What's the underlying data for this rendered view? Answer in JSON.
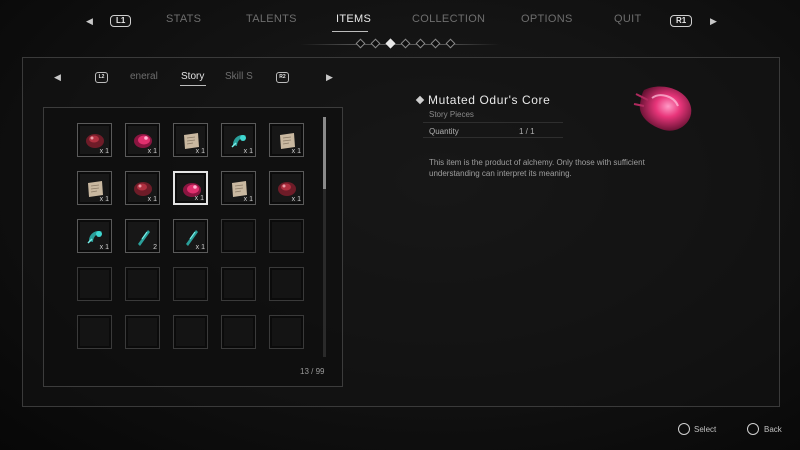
{
  "nav": {
    "left_button": "L1",
    "right_button": "R1",
    "tabs": [
      {
        "label": "STATS",
        "active": false
      },
      {
        "label": "TALENTS",
        "active": false
      },
      {
        "label": "ITEMS",
        "active": true
      },
      {
        "label": "COLLECTION",
        "active": false
      },
      {
        "label": "OPTIONS",
        "active": false
      },
      {
        "label": "QUIT",
        "active": false
      }
    ],
    "page_dots": 7,
    "active_dot": 2
  },
  "subtabs": {
    "left_button": "L2",
    "right_button": "R2",
    "tabs": [
      {
        "label": "eneral",
        "active": false
      },
      {
        "label": "Story",
        "active": true
      },
      {
        "label": "Skill S",
        "active": false
      }
    ]
  },
  "grid": {
    "count": "13 / 99",
    "slots": [
      {
        "icon": "red-core-icon",
        "qty": "x 1"
      },
      {
        "icon": "pink-core-icon",
        "qty": "x 1"
      },
      {
        "icon": "note-icon",
        "qty": "x 1"
      },
      {
        "icon": "cyan-crystal-icon",
        "qty": "x 1"
      },
      {
        "icon": "note-icon",
        "qty": "x 1"
      },
      {
        "icon": "note-icon",
        "qty": "x 1"
      },
      {
        "icon": "red-core-icon",
        "qty": "x 1"
      },
      {
        "icon": "pink-core-icon",
        "qty": "x 1",
        "selected": true
      },
      {
        "icon": "note-icon",
        "qty": "x 1"
      },
      {
        "icon": "red-core-icon",
        "qty": "x 1"
      },
      {
        "icon": "cyan-crystal-icon",
        "qty": "x 1"
      },
      {
        "icon": "cyan-shard-icon",
        "qty": "2"
      },
      {
        "icon": "cyan-shard-icon",
        "qty": "x 1"
      }
    ]
  },
  "detail": {
    "name": "Mutated Odur's Core",
    "category": "Story Pieces",
    "quantity_label": "Quantity",
    "quantity_value": "1 / 1",
    "description": "This item is the product of alchemy. Only those with sufficient understanding can interpret its meaning.",
    "icon": "mutated-core-icon"
  },
  "footer": {
    "select_label": "Select",
    "back_label": "Back"
  },
  "colors": {
    "accent": "#e8e8e8",
    "core_pink": "#e0306e",
    "core_red": "#b03040",
    "crystal_cyan": "#3fd7d0"
  }
}
